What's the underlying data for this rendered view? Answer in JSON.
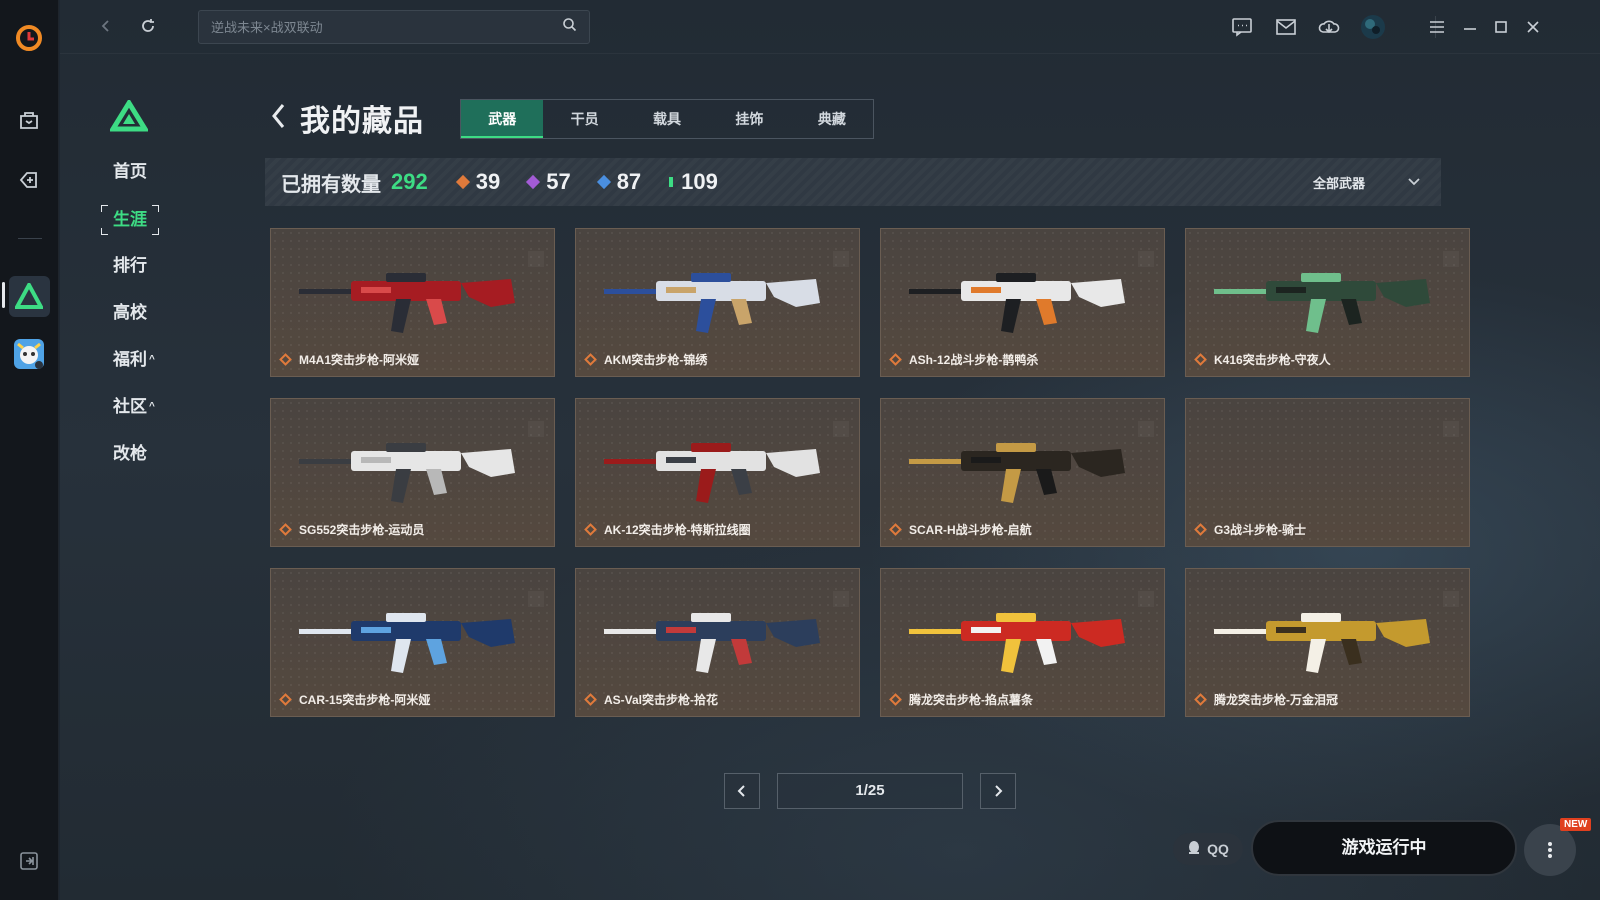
{
  "search": {
    "placeholder": "逆战未来×战双联动"
  },
  "sidebar": {
    "items": [
      {
        "label": "首页"
      },
      {
        "label": "生涯"
      },
      {
        "label": "排行"
      },
      {
        "label": "高校"
      },
      {
        "label": "福利",
        "caret": "^"
      },
      {
        "label": "社区",
        "caret": "^"
      },
      {
        "label": "改枪"
      }
    ]
  },
  "page": {
    "title": "我的藏品"
  },
  "tabs": [
    "武器",
    "干员",
    "载具",
    "挂饰",
    "典藏"
  ],
  "stats": {
    "owned_label": "已拥有数量",
    "owned_total": "292",
    "tiers": [
      {
        "value": "39",
        "color": "#e07a3b"
      },
      {
        "value": "57",
        "color": "#a35bd6"
      },
      {
        "value": "87",
        "color": "#4a8fe0"
      },
      {
        "value": "109",
        "color": "#3ddc84"
      }
    ],
    "filter_label": "全部武器"
  },
  "weapons": [
    {
      "name": "M4A1突击步枪-阿米娅",
      "colors": [
        "#a61c22",
        "#2a2d36",
        "#d94a4a"
      ]
    },
    {
      "name": "AKM突击步枪-锦绣",
      "colors": [
        "#d8dde6",
        "#2c4f9c",
        "#c9a46a"
      ]
    },
    {
      "name": "ASh-12战斗步枪-鹊鸭杀",
      "colors": [
        "#e8e8e8",
        "#1d1f22",
        "#e07a2b"
      ]
    },
    {
      "name": "K416突击步枪-守夜人",
      "colors": [
        "#2f4a3a",
        "#6fbf8c",
        "#1c2420"
      ]
    },
    {
      "name": "SG552突击步枪-运动员",
      "colors": [
        "#e6e6e6",
        "#3a3d42",
        "#b8b8b8"
      ]
    },
    {
      "name": "AK-12突击步枪-特斯拉线圈",
      "colors": [
        "#e2e2e2",
        "#9b1b1b",
        "#3b3f46"
      ]
    },
    {
      "name": "SCAR-H战斗步枪-启航",
      "colors": [
        "#2b2620",
        "#c49a45",
        "#1a1a1a"
      ]
    },
    {
      "name": "G3战斗步枪-骑士",
      "colors": []
    },
    {
      "name": "CAR-15突击步枪-阿米娅",
      "colors": [
        "#1f3a6b",
        "#dfe6ef",
        "#5ea3e0"
      ]
    },
    {
      "name": "AS-Val突击步枪-拾花",
      "colors": [
        "#2c3e5c",
        "#e8e8e8",
        "#c23a3a"
      ]
    },
    {
      "name": "腾龙突击步枪-掐点薯条",
      "colors": [
        "#cc2a22",
        "#f0c23c",
        "#f2f2f2"
      ]
    },
    {
      "name": "腾龙突击步枪-万金泪冠",
      "colors": [
        "#c49a2e",
        "#f4f0e6",
        "#3a2f1e"
      ]
    }
  ],
  "pager": {
    "current": "1/25"
  },
  "qq_label": "QQ",
  "launch_label": "游戏运行中",
  "new_badge": "NEW"
}
